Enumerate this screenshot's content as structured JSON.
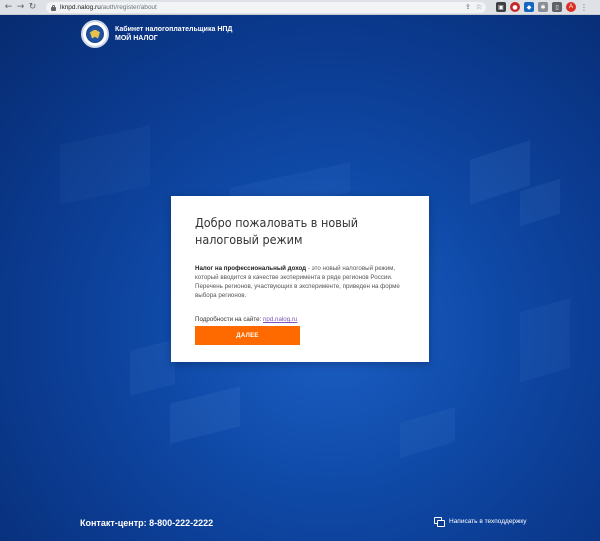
{
  "browser": {
    "back_icon": "arrow-left-icon",
    "forward_icon": "arrow-right-icon",
    "reload_icon": "reload-icon",
    "url_host": "lknpd.nalog.ru",
    "url_path": "/auth/register/about",
    "profile_initial": "A"
  },
  "header": {
    "brand_line1": "Кабинет налогоплательщика НПД",
    "brand_line2": "МОЙ НАЛОГ"
  },
  "card": {
    "title": "Добро пожаловать в новый налоговый режим",
    "desc_bold": "Налог на профессиональный доход",
    "desc_rest": " - это новый налоговый режим, который вводится в качестве эксперимента в ряде регионов России. Перечень регионов, участвующих в эксперименте, приведен на форме выбора регионов.",
    "more_label": "Подробности на сайте: ",
    "more_link": "npd.nalog.ru",
    "next_button": "ДАЛЕЕ"
  },
  "footer": {
    "contact": "Контакт-центр: 8-800-222-2222",
    "support": "Написать в техподдержку"
  },
  "colors": {
    "accent": "#ff6a00",
    "background": "#0b3a8f",
    "link": "#7b56b8"
  }
}
